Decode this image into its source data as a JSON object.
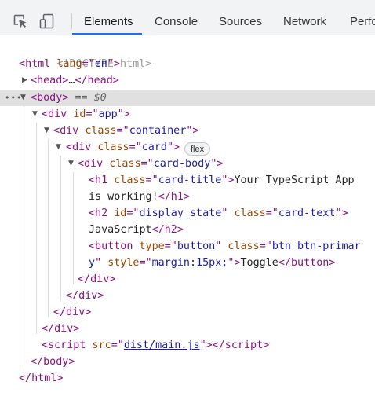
{
  "toolbar": {
    "tabs": [
      {
        "label": "Elements",
        "active": true
      },
      {
        "label": "Console"
      },
      {
        "label": "Sources"
      },
      {
        "label": "Network"
      },
      {
        "label": "Perfo"
      }
    ],
    "icons": [
      "inspect-element-icon",
      "device-toggle-icon"
    ]
  },
  "dom": {
    "doctype": "<!DOCTYPE html>",
    "html_open": {
      "tag": "html",
      "attr": "lang",
      "value": "en"
    },
    "head": {
      "open": "<head>",
      "ellipsis": "…",
      "close": "</head>"
    },
    "body": {
      "tag": "body",
      "selected_marker": "== $0",
      "dots": "•••"
    },
    "div_app": {
      "tag": "div",
      "attr": "id",
      "value": "app"
    },
    "div_container": {
      "tag": "div",
      "attr": "class",
      "value": "container"
    },
    "div_card": {
      "tag": "div",
      "attr": "class",
      "value": "card",
      "badge": "flex"
    },
    "div_card_body": {
      "tag": "div",
      "attr": "class",
      "value": "card-body"
    },
    "h1": {
      "attr": "class",
      "value": "card-title",
      "text_line1": "Your TypeScript App",
      "text_line2": "is working!"
    },
    "h2": {
      "attr1": "id",
      "value1": "display_state",
      "attr2": "class",
      "value2": "card-text",
      "text": "JavaScript"
    },
    "button": {
      "attr1": "type",
      "value1": "button",
      "attr2": "class",
      "value2_part1": "btn btn-primar",
      "value2_part2": "y",
      "attr3": "style",
      "value3": "margin:15px;",
      "text": "Toggle"
    },
    "script": {
      "attr": "src",
      "value": "dist/main.js"
    }
  }
}
